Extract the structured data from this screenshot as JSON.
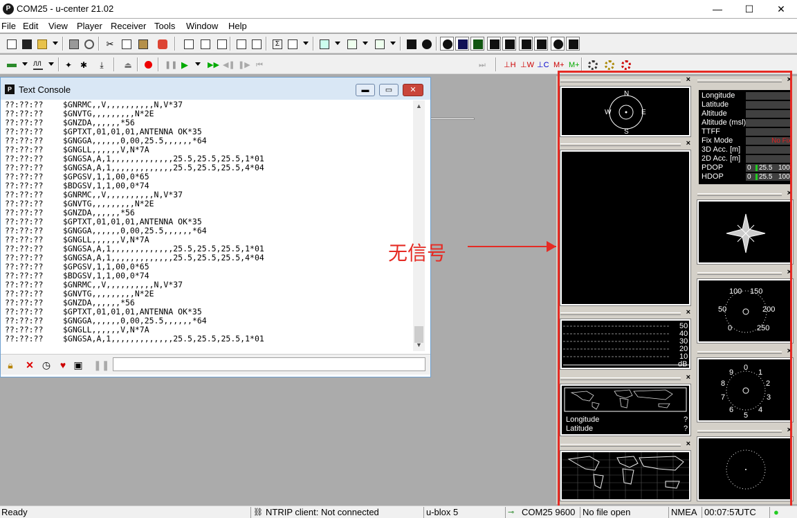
{
  "window": {
    "title": "COM25 - u-center 21.02",
    "app_icon_letter": "P",
    "minimize": "—",
    "maximize": "☐",
    "close": "✕"
  },
  "menu": [
    "File",
    "Edit",
    "View",
    "Player",
    "Receiver",
    "Tools",
    "Window",
    "Help"
  ],
  "toolbar": {
    "icon_names": [
      "new-icon",
      "save-icon",
      "open-icon",
      "print-icon",
      "cut-icon",
      "copy-icon",
      "paste-icon",
      "stop-icon",
      "config-icon",
      "pvt-icon",
      "table-icon",
      "sky-icon",
      "chart-icon",
      "deviation-icon",
      "histogram-icon",
      "camera-icon",
      "dashboard-icon",
      "nmea-icon",
      "binary-icon",
      "messages-icon",
      "statistics-icon",
      "signal-icon",
      "sky-view-icon",
      "satellite-icon",
      "compass-icon",
      "map-icon"
    ]
  },
  "console": {
    "title": "Text Console",
    "icon_letter": "P",
    "lines": [
      {
        "ts": "??:??:??",
        "msg": "$GNRMC,,V,,,,,,,,,,N,V*37"
      },
      {
        "ts": "??:??:??",
        "msg": "$GNVTG,,,,,,,,,N*2E"
      },
      {
        "ts": "??:??:??",
        "msg": "$GNZDA,,,,,,*56"
      },
      {
        "ts": "??:??:??",
        "msg": "$GPTXT,01,01,01,ANTENNA OK*35"
      },
      {
        "ts": "??:??:??",
        "msg": "$GNGGA,,,,,,0,00,25.5,,,,,,*64"
      },
      {
        "ts": "??:??:??",
        "msg": "$GNGLL,,,,,,V,N*7A"
      },
      {
        "ts": "??:??:??",
        "msg": "$GNGSA,A,1,,,,,,,,,,,,,25.5,25.5,25.5,1*01"
      },
      {
        "ts": "??:??:??",
        "msg": "$GNGSA,A,1,,,,,,,,,,,,,25.5,25.5,25.5,4*04"
      },
      {
        "ts": "??:??:??",
        "msg": "$GPGSV,1,1,00,0*65"
      },
      {
        "ts": "??:??:??",
        "msg": "$BDGSV,1,1,00,0*74"
      },
      {
        "ts": "??:??:??",
        "msg": "$GNRMC,,V,,,,,,,,,,N,V*37"
      },
      {
        "ts": "??:??:??",
        "msg": "$GNVTG,,,,,,,,,N*2E"
      },
      {
        "ts": "??:??:??",
        "msg": "$GNZDA,,,,,,*56"
      },
      {
        "ts": "??:??:??",
        "msg": "$GPTXT,01,01,01,ANTENNA OK*35"
      },
      {
        "ts": "??:??:??",
        "msg": "$GNGGA,,,,,,0,00,25.5,,,,,,*64"
      },
      {
        "ts": "??:??:??",
        "msg": "$GNGLL,,,,,,V,N*7A"
      },
      {
        "ts": "??:??:??",
        "msg": "$GNGSA,A,1,,,,,,,,,,,,,25.5,25.5,25.5,1*01"
      },
      {
        "ts": "??:??:??",
        "msg": "$GNGSA,A,1,,,,,,,,,,,,,25.5,25.5,25.5,4*04"
      },
      {
        "ts": "??:??:??",
        "msg": "$GPGSV,1,1,00,0*65"
      },
      {
        "ts": "??:??:??",
        "msg": "$BDGSV,1,1,00,0*74"
      },
      {
        "ts": "??:??:??",
        "msg": "$GNRMC,,V,,,,,,,,,,N,V*37"
      },
      {
        "ts": "??:??:??",
        "msg": "$GNVTG,,,,,,,,,N*2E"
      },
      {
        "ts": "??:??:??",
        "msg": "$GNZDA,,,,,,*56"
      },
      {
        "ts": "??:??:??",
        "msg": "$GPTXT,01,01,01,ANTENNA OK*35"
      },
      {
        "ts": "??:??:??",
        "msg": "$GNGGA,,,,,,0,00,25.5,,,,,,*64"
      },
      {
        "ts": "??:??:??",
        "msg": "$GNGLL,,,,,,V,N*7A"
      },
      {
        "ts": "??:??:??",
        "msg": "$GNGSA,A,1,,,,,,,,,,,,,25.5,25.5,25.5,1*01"
      }
    ]
  },
  "compass": {
    "n": "N",
    "s": "S",
    "e": "E",
    "w": "W"
  },
  "signal": {
    "levels": [
      "50",
      "40",
      "30",
      "20",
      "10"
    ],
    "unit": "dB"
  },
  "mini_map": {
    "lon_label": "Longitude",
    "lat_label": "Latitude",
    "lon_value": "?",
    "lat_value": "?"
  },
  "nav_table": {
    "rows": [
      {
        "label": "Longitude",
        "value": ""
      },
      {
        "label": "Latitude",
        "value": ""
      },
      {
        "label": "Altitude",
        "value": ""
      },
      {
        "label": "Altitude (msl)",
        "value": ""
      },
      {
        "label": "TTFF",
        "value": ""
      },
      {
        "label": "Fix Mode",
        "value": "No Fix"
      },
      {
        "label": "3D Acc. [m]",
        "value": ""
      },
      {
        "label": "2D Acc. [m]",
        "value": ""
      }
    ],
    "dop": [
      {
        "label": "PDOP",
        "min": "0",
        "value": "25.5",
        "max": "100"
      },
      {
        "label": "HDOP",
        "min": "0",
        "value": "25.5",
        "max": "100"
      }
    ]
  },
  "speed_gauge": {
    "labels": [
      "0",
      "50",
      "100",
      "150",
      "200",
      "250"
    ]
  },
  "clock_gauge": {
    "labels": [
      "0",
      "1",
      "2",
      "3",
      "4",
      "5",
      "6",
      "7",
      "8",
      "9"
    ]
  },
  "annotation": {
    "text": "无信号",
    "color": "#e52b24"
  },
  "status": {
    "ready": "Ready",
    "ntrip": "NTRIP client: Not connected",
    "receiver": "u-blox 5",
    "port": "COM25 9600",
    "file": "No file open",
    "protocol": "NMEA",
    "time": "00:07:57",
    "tz": "UTC"
  }
}
